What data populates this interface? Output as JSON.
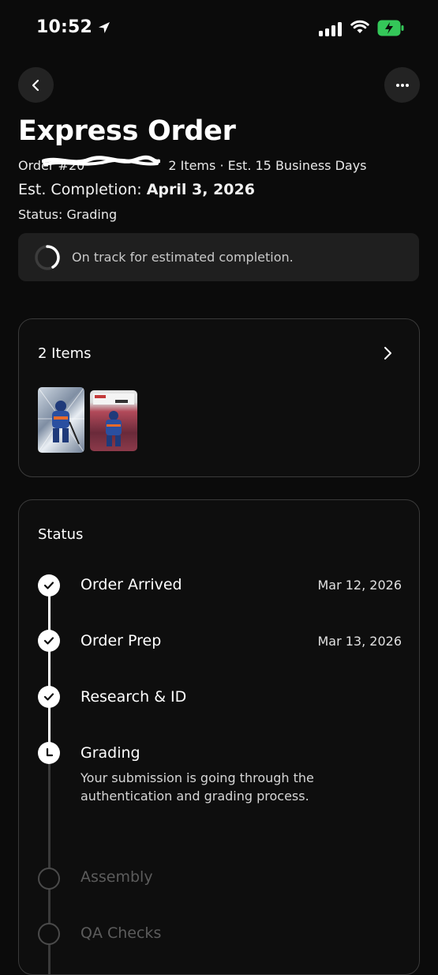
{
  "status_bar": {
    "time": "10:52",
    "location_icon": "navigation-arrow-icon",
    "signal_icon": "cellular-signal-icon",
    "wifi_icon": "wifi-icon",
    "battery_icon": "battery-charging-icon"
  },
  "header": {
    "back_icon": "chevron-left-icon",
    "more_icon": "more-horizontal-icon"
  },
  "order": {
    "title": "Express Order",
    "number_prefix": "Order #20",
    "meta": "2 Items · Est. 15 Business Days",
    "est_label": "Est. Completion:",
    "est_date": "April 3, 2026",
    "status": "Status: Grading"
  },
  "banner": {
    "text": "On track for estimated completion."
  },
  "items_card": {
    "title": "2 Items",
    "thumbnails": [
      {
        "name": "hockey-card-thumbnail-1"
      },
      {
        "name": "hockey-card-thumbnail-2"
      }
    ]
  },
  "status_card": {
    "title": "Status",
    "steps": [
      {
        "label": "Order Arrived",
        "date": "Mar 12, 2026",
        "state": "complete"
      },
      {
        "label": "Order Prep",
        "date": "Mar 13, 2026",
        "state": "complete"
      },
      {
        "label": "Research & ID",
        "date": "",
        "state": "complete"
      },
      {
        "label": "Grading",
        "date": "",
        "state": "current",
        "description": "Your submission is going through the authentication and grading process."
      },
      {
        "label": "Assembly",
        "date": "",
        "state": "pending"
      },
      {
        "label": "QA Checks",
        "date": "",
        "state": "pending"
      }
    ]
  },
  "colors": {
    "background": "#0b0b0b",
    "card_border": "#3a3a3a",
    "banner_bg": "#1f1f1f",
    "battery_green": "#34c759",
    "pending_text": "#5c5c5c"
  }
}
